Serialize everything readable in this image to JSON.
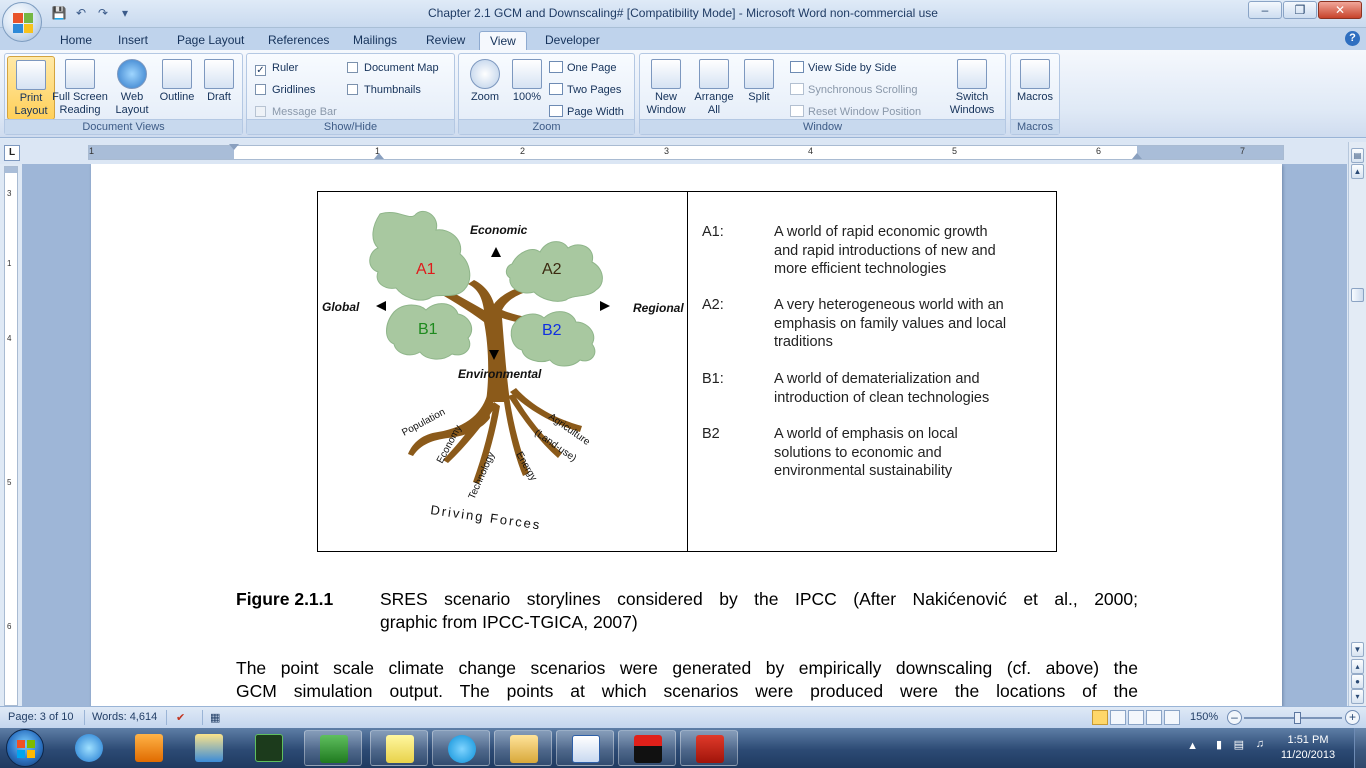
{
  "window": {
    "title": "Chapter 2.1 GCM and Downscaling# [Compatibility Mode] - Microsoft Word non-commercial use"
  },
  "tabs": [
    {
      "label": "Home"
    },
    {
      "label": "Insert"
    },
    {
      "label": "Page Layout"
    },
    {
      "label": "References"
    },
    {
      "label": "Mailings"
    },
    {
      "label": "Review"
    },
    {
      "label": "View"
    },
    {
      "label": "Developer"
    }
  ],
  "ribbon": {
    "document_views": {
      "label": "Document Views",
      "print_layout": "Print Layout",
      "full_screen_reading": "Full Screen Reading",
      "web_layout": "Web Layout",
      "outline": "Outline",
      "draft": "Draft"
    },
    "show_hide": {
      "label": "Show/Hide",
      "ruler": "Ruler",
      "gridlines": "Gridlines",
      "message_bar": "Message Bar",
      "document_map": "Document Map",
      "thumbnails": "Thumbnails"
    },
    "zoom": {
      "label": "Zoom",
      "zoom": "Zoom",
      "hundred": "100%",
      "one_page": "One Page",
      "two_pages": "Two Pages",
      "page_width": "Page Width"
    },
    "window": {
      "label": "Window",
      "new_window": "New Window",
      "arrange_all": "Arrange All",
      "split": "Split",
      "view_side_by_side": "View Side by Side",
      "synchronous_scrolling": "Synchronous Scrolling",
      "reset_window_position": "Reset Window Position",
      "switch_windows": "Switch Windows"
    },
    "macros": {
      "label": "Macros",
      "macros": "Macros"
    }
  },
  "ruler": {
    "h_numbers": [
      "1",
      "1",
      "2",
      "3",
      "4",
      "5",
      "6",
      "7"
    ],
    "v_numbers": [
      "3",
      "1",
      "4",
      "5",
      "6"
    ]
  },
  "figure": {
    "diagram": {
      "economic": "Economic",
      "environmental": "Environmental",
      "global": "Global",
      "regional": "Regional",
      "a1": "A1",
      "a2": "A2",
      "b1": "B1",
      "b2": "B2",
      "population": "Population",
      "economy": "Economy",
      "technology": "Technology",
      "energy": "Energy",
      "agriculture": "Agriculture",
      "land_use": "(Land-use)",
      "driving_forces": "Driving Forces"
    },
    "scenarios": [
      {
        "code": "A1:",
        "desc": [
          "A world of rapid economic growth",
          "and rapid introductions of new and",
          "more efficient technologies"
        ]
      },
      {
        "code": "A2:",
        "desc": [
          "A very heterogeneous world with an",
          "emphasis on family values and local",
          "traditions"
        ]
      },
      {
        "code": "B1:",
        "desc": [
          "A world of dematerialization and",
          "introduction of clean technologies"
        ]
      },
      {
        "code": "B2",
        "desc": [
          "A world of emphasis on local",
          "solutions to economic and",
          "environmental sustainability"
        ]
      }
    ]
  },
  "caption": {
    "label": "Figure 2.1.1",
    "line1": "SRES scenario storylines considered by the IPCC (After Nakićenović et al., 2000;",
    "line2": "graphic from IPCC-TGICA, 2007)"
  },
  "body": {
    "line1": "The point scale climate change scenarios were generated by empirically downscaling (cf. above) the",
    "line2": "GCM simulation output. The points at which scenarios were produced were the locations of the"
  },
  "status": {
    "page": "Page: 3 of 10",
    "words": "Words: 4,614",
    "zoom": "150%"
  },
  "taskbar": {
    "time": "1:51 PM",
    "date": "11/20/2013"
  },
  "colors": {
    "tree_trunk": "#8b5a1a",
    "leaves": "#a8c8a0",
    "a_label": "#e01b1b",
    "a2_label": "#3b2a10",
    "b1_label": "#1e8a1e",
    "b2_label": "#1030e0"
  }
}
